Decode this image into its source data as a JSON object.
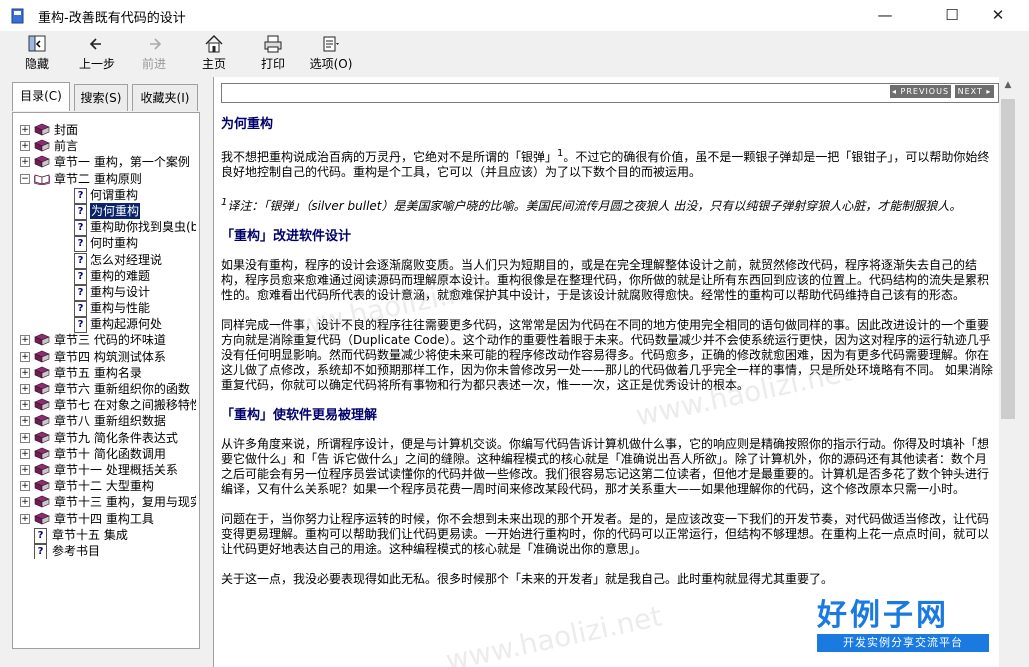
{
  "window": {
    "title": "重构-改善既有代码的设计",
    "minimize": "—",
    "maximize": "☐",
    "close": "✕"
  },
  "toolbar": {
    "hide": "隐藏",
    "back": "上一步",
    "forward": "前进",
    "home": "主页",
    "print": "打印",
    "options": "选项(O)"
  },
  "tabs": {
    "contents": "目录(C)",
    "search": "搜索(S)",
    "favorites": "收藏夹(I)"
  },
  "tree": [
    {
      "label": "封面",
      "type": "book",
      "box": "+"
    },
    {
      "label": "前言",
      "type": "book",
      "box": "+"
    },
    {
      "label": "章节一  重构，第一个案例",
      "type": "book",
      "box": "+"
    },
    {
      "label": "章节二  重构原则",
      "type": "openbook",
      "box": "−"
    },
    {
      "label": "何谓重构",
      "type": "page"
    },
    {
      "label": "为何重构",
      "type": "page",
      "selected": true
    },
    {
      "label": "重构助你找到臭虫(bugs)",
      "type": "page"
    },
    {
      "label": "何时重构",
      "type": "page"
    },
    {
      "label": "怎么对经理说",
      "type": "page"
    },
    {
      "label": "重构的难题",
      "type": "page"
    },
    {
      "label": "重构与设计",
      "type": "page"
    },
    {
      "label": "重构与性能",
      "type": "page"
    },
    {
      "label": "重构起源何处",
      "type": "page"
    },
    {
      "label": "章节三  代码的坏味道",
      "type": "book",
      "box": "+"
    },
    {
      "label": "章节四  构筑测试体系",
      "type": "book",
      "box": "+"
    },
    {
      "label": "章节五  重构名录",
      "type": "book",
      "box": "+"
    },
    {
      "label": "章节六  重新组织你的函数",
      "type": "book",
      "box": "+"
    },
    {
      "label": "章节七  在对象之间搬移特性",
      "type": "book",
      "box": "+"
    },
    {
      "label": "章节八  重新组织数据",
      "type": "book",
      "box": "+"
    },
    {
      "label": "章节九  简化条件表达式",
      "type": "book",
      "box": "+"
    },
    {
      "label": "章节十  简化函数调用",
      "type": "book",
      "box": "+"
    },
    {
      "label": "章节十一  处理概括关系",
      "type": "book",
      "box": "+"
    },
    {
      "label": "章节十二  大型重构",
      "type": "book",
      "box": "+"
    },
    {
      "label": "章节十三  重构，复用与现实",
      "type": "book",
      "box": "+"
    },
    {
      "label": "章节十四  重构工具",
      "type": "book",
      "box": "+"
    },
    {
      "label": "章节十五  集成",
      "type": "page"
    },
    {
      "label": "参考书目",
      "type": "page"
    }
  ],
  "nav": {
    "previous": "◂ PREVIOUS",
    "next": "NEXT ▸"
  },
  "article": {
    "title": "为何重构",
    "p1a": "我不想把重构说成治百病的万灵丹，它绝对不是所谓的「银弹」",
    "p1sup": "1",
    "p1b": "。不过它的确很有价值，虽不是一颗银子弹却是一把「银钳子」，可以帮助你始终良好地控制自己的代码。重构是个工具，它可以（并且应该）为了以下数个目的而被运用。",
    "note_sup": "1",
    "note": "译注：「银弹」（silver bullet）是美国家喻户晓的比喻。美国民间流传月圆之夜狼人 出没，只有以纯银子弹射穿狼人心脏，才能制服狼人。",
    "h2": "「重构」改进软件设计",
    "p2": "如果没有重构，程序的设计会逐渐腐败变质。当人们只为短期目的，或是在完全理解整体设计之前，就贸然修改代码，程序将逐渐失去自己的结构，程序员愈来愈难通过阅读源码而理解原本设计。重构很像是在整理代码，你所做的就是让所有东西回到应该的位置上。代码结构的流失是累积性的。愈难看出代码所代表的设计意涵，就愈难保护其中设计，于是该设计就腐败得愈快。经常性的重构可以帮助代码维持自己该有的形态。",
    "p3": "同样完成一件事，设计不良的程序往往需要更多代码，这常常是因为代码在不同的地方使用完全相同的语句做同样的事。因此改进设计的一个重要方向就是消除重复代码（Duplicate Code）。这个动作的重要性着眼于未来。代码数量减少并不会使系统运行更快，因为这对程序的运行轨迹几乎没有任何明显影响。然而代码数量减少将使未来可能的程序修改动作容易得多。代码愈多，正确的修改就愈困难，因为有更多代码需要理解。你在这儿做了点修改，系统却不如预期那样工作，因为你未曾修改另一处——那儿的代码做着几乎完全一样的事情，只是所处环境略有不同。 如果消除重复代码，你就可以确定代码将所有事物和行为都只表述一次，惟一一次，这正是优秀设计的根本。",
    "h3": "「重构」使软件更易被理解",
    "p4": "从许多角度来说，所谓程序设计，便是与计算机交谈。你编写代码告诉计算机做什么事，它的响应则是精确按照你的指示行动。你得及时填补「想要它做什么」和「告 诉它做什么」之间的缝隙。这种编程模式的核心就是「准确说出吾人所欲」。除了计算机外，你的源码还有其他读者：数个月之后可能会有另一位程序员尝试读懂你的代码并做一些修改。我们很容易忘记这第二位读者，但他才是最重要的。计算机是否多花了数个钟头进行编译，又有什么关系呢？如果一个程序员花费一周时间来修改某段代码，那才关系重大——如果他理解你的代码，这个修改原本只需一小时。",
    "p5": "问题在于，当你努力让程序运转的时候，你不会想到未来出现的那个开发者。是的，是应该改变一下我们的开发节奏，对代码做适当修改，让代码变得更易理解。重构可以帮助我们让代码更易读。一开始进行重构时，你的代码可以正常运行，但结构不够理想。在重构上花一点点时间，就可以让代码更好地表达自己的用途。这种编程模式的核心就是「准确说出你的意思」。",
    "p6": "关于这一点，我没必要表现得如此无私。很多时候那个「未来的开发者」就是我自己。此时重构就显得尤其重要了。"
  },
  "watermark": {
    "text": "www.haolizi.net",
    "logo_big": "好例子网",
    "logo_small": "开发实例分享交流平台"
  }
}
